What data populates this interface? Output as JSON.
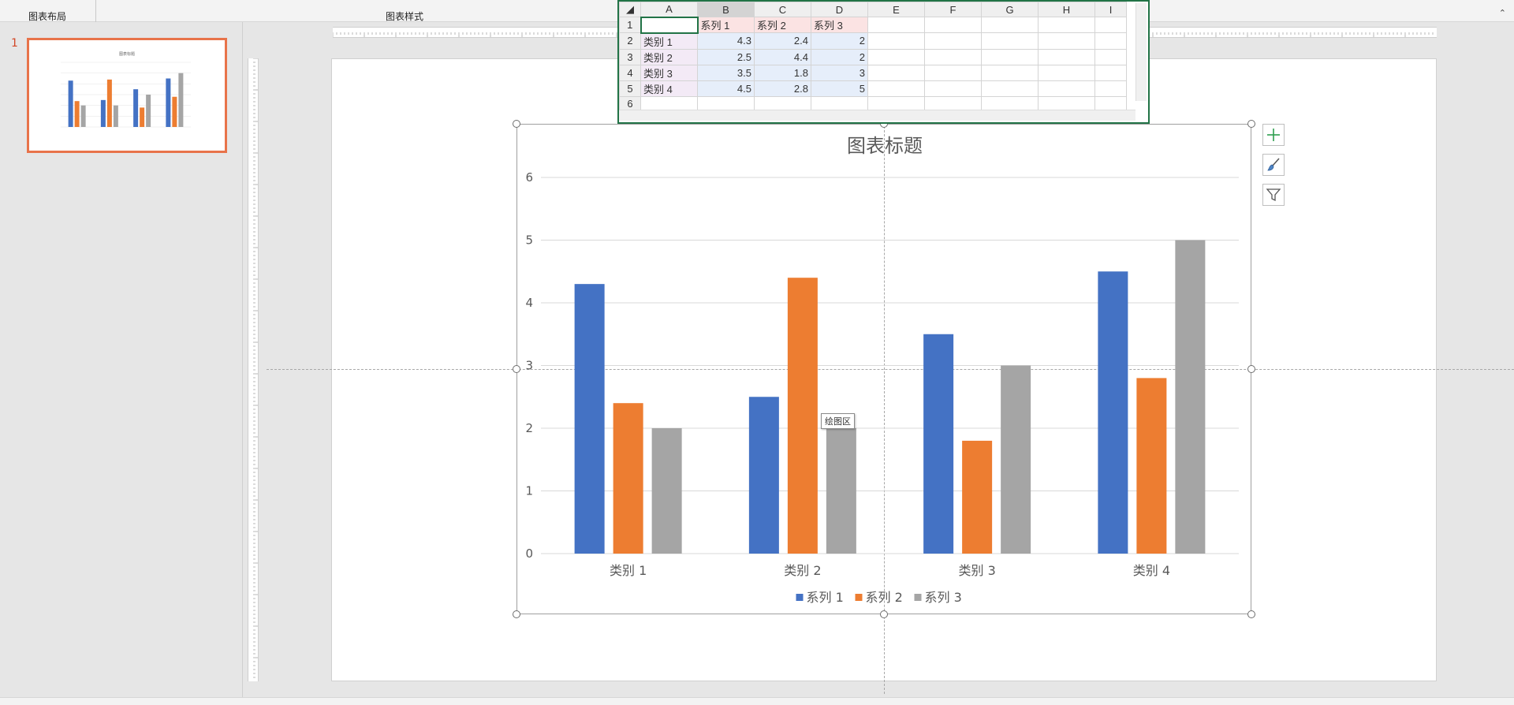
{
  "ribbon": {
    "group_layout": "图表布局",
    "group_styles": "图表样式"
  },
  "thumbnail": {
    "slide_number": "1"
  },
  "sheet": {
    "columns": [
      "A",
      "B",
      "C",
      "D",
      "E",
      "F",
      "G",
      "H",
      "I"
    ],
    "rows": [
      {
        "num": "1",
        "cells": [
          "",
          "系列 1",
          "系列 2",
          "系列 3",
          "",
          "",
          "",
          "",
          ""
        ]
      },
      {
        "num": "2",
        "cells": [
          "类别 1",
          "4.3",
          "2.4",
          "2",
          "",
          "",
          "",
          "",
          ""
        ]
      },
      {
        "num": "3",
        "cells": [
          "类别 2",
          "2.5",
          "4.4",
          "2",
          "",
          "",
          "",
          "",
          ""
        ]
      },
      {
        "num": "4",
        "cells": [
          "类别 3",
          "3.5",
          "1.8",
          "3",
          "",
          "",
          "",
          "",
          ""
        ]
      },
      {
        "num": "5",
        "cells": [
          "类别 4",
          "4.5",
          "2.8",
          "5",
          "",
          "",
          "",
          "",
          ""
        ]
      },
      {
        "num": "6",
        "cells": [
          "",
          "",
          "",
          "",
          "",
          "",
          "",
          "",
          ""
        ]
      }
    ]
  },
  "chart_data": {
    "type": "bar",
    "title": "图表标题",
    "categories": [
      "类别 1",
      "类别 2",
      "类别 3",
      "类别 4"
    ],
    "series": [
      {
        "name": "系列 1",
        "values": [
          4.3,
          2.5,
          3.5,
          4.5
        ],
        "color": "#4472c4"
      },
      {
        "name": "系列 2",
        "values": [
          2.4,
          4.4,
          1.8,
          2.8
        ],
        "color": "#ed7d31"
      },
      {
        "name": "系列 3",
        "values": [
          2,
          2,
          3,
          5
        ],
        "color": "#a5a5a5"
      }
    ],
    "ylim": [
      0,
      6
    ],
    "yticks": [
      "0",
      "1",
      "2",
      "3",
      "4",
      "5",
      "6"
    ],
    "grid": true,
    "legend": "bottom"
  },
  "tooltip": "绘图区",
  "icons": {
    "add": "plus-icon",
    "style": "brush-icon",
    "filter": "funnel-icon"
  }
}
